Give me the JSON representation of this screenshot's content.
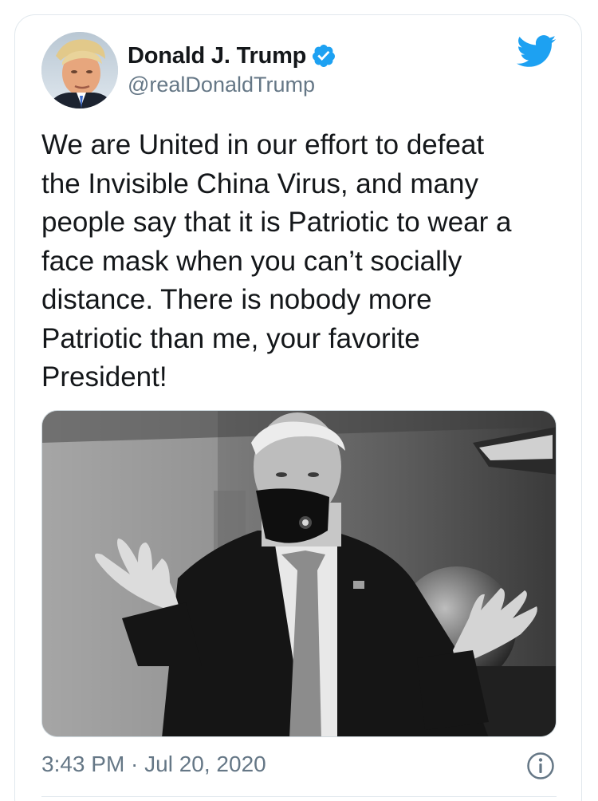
{
  "tweet": {
    "author": {
      "display_name": "Donald J. Trump",
      "handle": "@realDonaldTrump",
      "verified": true,
      "avatar_icon": "profile-photo"
    },
    "brand_icon": "twitter-bird-icon",
    "text": "We are United in our effort to defeat\nthe Invisible China Virus, and many\npeople say that it is Patriotic to wear a\nface mask when you can’t socially\ndistance. There is nobody more\nPatriotic than me, your favorite\nPresident!",
    "media": {
      "kind": "photo",
      "style": "black-and-white"
    },
    "timestamp": "3:43 PM · Jul 20, 2020",
    "info_icon": "info-icon"
  },
  "colors": {
    "twitter_blue": "#1da1f2",
    "text_primary": "#14171a",
    "text_secondary": "#657786",
    "border": "#e1e8ed"
  }
}
